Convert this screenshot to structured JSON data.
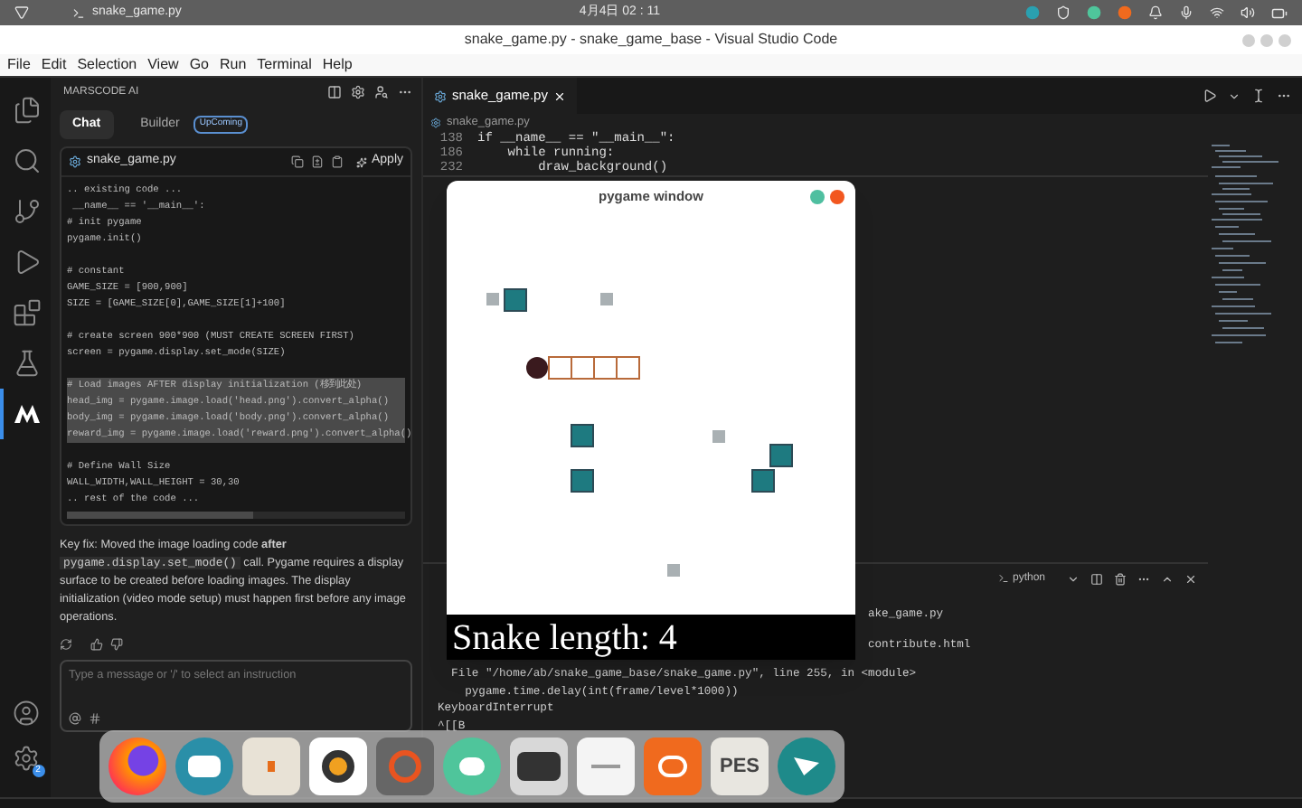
{
  "top_bar": {
    "app": "snake_game.py",
    "clock": "4月4日 02 : 11"
  },
  "window": {
    "title": "snake_game.py - snake_game_base - Visual Studio Code"
  },
  "menu": [
    "File",
    "Edit",
    "Selection",
    "View",
    "Go",
    "Run",
    "Terminal",
    "Help"
  ],
  "activity": [
    {
      "kind": "files",
      "selected": false
    },
    {
      "kind": "search",
      "selected": false
    },
    {
      "kind": "git",
      "selected": false
    },
    {
      "kind": "debug",
      "selected": false
    },
    {
      "kind": "extensions",
      "selected": false
    },
    {
      "kind": "testing",
      "selected": false
    },
    {
      "kind": "marscode",
      "selected": true
    }
  ],
  "settings_badge": "2",
  "side_panel": {
    "title": "MARSCODE AI",
    "tabs": [
      {
        "label": "Chat",
        "selected": true
      },
      {
        "label": "Builder",
        "selected": false
      }
    ],
    "badge": "UpComing",
    "code_card": {
      "file": "snake_game.py",
      "action": "Apply",
      "blocks": [
        [
          {
            "text": ".. existing code ...",
            "highlighted": false
          },
          {
            "text": " __name__ == '__main__':",
            "highlighted": false
          },
          {
            "text": "# init pygame",
            "highlighted": false
          },
          {
            "text": "pygame.init()",
            "highlighted": false
          }
        ],
        [
          {
            "text": "# constant",
            "highlighted": false
          },
          {
            "text": "GAME_SIZE = [900,900]",
            "highlighted": false
          },
          {
            "text": "SIZE = [GAME_SIZE[0],GAME_SIZE[1]+100]",
            "highlighted": false
          }
        ],
        [
          {
            "text": "# create screen 900*900 (MUST CREATE SCREEN FIRST)",
            "highlighted": false
          },
          {
            "text": "screen = pygame.display.set_mode(SIZE)",
            "highlighted": false
          }
        ],
        [
          {
            "text": "# Load images AFTER display initialization (移到此处)",
            "highlighted": true
          },
          {
            "text": "head_img = pygame.image.load('head.png').convert_alpha()",
            "highlighted": true
          },
          {
            "text": "body_img = pygame.image.load('body.png').convert_alpha()",
            "highlighted": true
          },
          {
            "text": "reward_img = pygame.image.load('reward.png').convert_alpha()",
            "highlighted": true
          }
        ],
        [
          {
            "text": "# Define Wall Size",
            "highlighted": false
          },
          {
            "text": "WALL_WIDTH,WALL_HEIGHT = 30,30",
            "highlighted": false
          },
          {
            "text": ".. rest of the code ...",
            "highlighted": false
          }
        ]
      ]
    },
    "explanation": {
      "lead": "Key fix: Moved the image loading code **after**",
      "code": "pygame.display.set_mode()",
      "rest": "call. Pygame requires a display surface to be created before loading images. The display initialization (video mode setup) must happen first before any image operations."
    },
    "input": {
      "placeholder": "Type a message or '/' to select an instruction"
    }
  },
  "editor": {
    "tab": {
      "label": "snake_game.py",
      "selected": true
    },
    "breadcrumb": "snake_game.py",
    "sticky_lines": [
      {
        "number": "138",
        "code": "if __name__ == \"__main__\":"
      },
      {
        "number": "186",
        "code": "    while running:"
      },
      {
        "number": "232",
        "code": "        draw_background()"
      }
    ]
  },
  "terminal": {
    "shell": "python",
    "lines": [
      {
        "kind": "fragment",
        "text": "ake_game.py"
      },
      {
        "kind": "fragment",
        "text": "contribute.html"
      },
      {
        "kind": "line",
        "text": "  File \"/home/ab/snake_game_base/snake_game.py\", line 255, in <module>"
      },
      {
        "kind": "line",
        "text": "    pygame.time.delay(int(frame/level*1000))"
      },
      {
        "kind": "line",
        "text": "KeyboardInterrupt"
      },
      {
        "kind": "line",
        "text": "^[[B"
      }
    ]
  },
  "pygame_window": {
    "title": "pygame window",
    "score": "Snake length: 4"
  },
  "dock": {
    "apps": [
      {
        "kind": "firefox"
      },
      {
        "kind": "mail"
      },
      {
        "kind": "folder"
      },
      {
        "kind": "speaker"
      },
      {
        "kind": "ubuntu"
      },
      {
        "kind": "chat"
      },
      {
        "kind": "terminal"
      },
      {
        "kind": "editor"
      },
      {
        "kind": "orange"
      },
      {
        "kind": "pes",
        "label": "PES"
      },
      {
        "kind": "bird"
      }
    ]
  }
}
